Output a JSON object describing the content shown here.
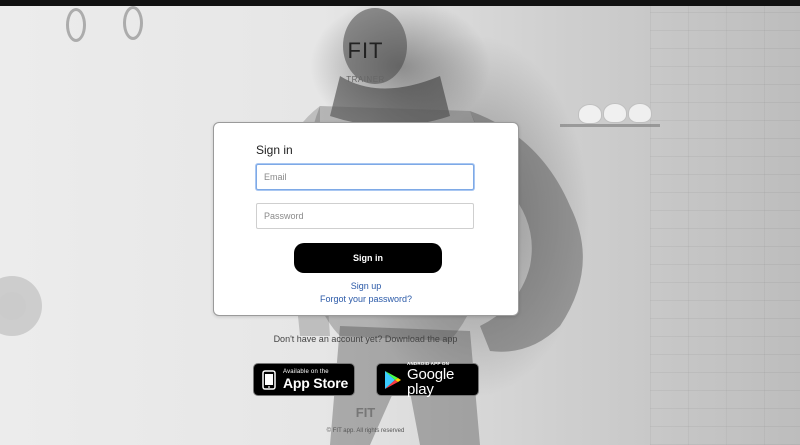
{
  "brand": {
    "title": "FIT",
    "subtitle": "TRAINER"
  },
  "login": {
    "heading": "Sign in",
    "email_placeholder": "Email",
    "email_value": "",
    "password_placeholder": "Password",
    "password_value": "",
    "submit_label": "Sign in",
    "signup_link": "Sign up",
    "forgot_link": "Forgot your password?"
  },
  "download": {
    "prompt": "Don't have an account yet? Download the app",
    "app_store": {
      "small_text": "Available on the",
      "big_text": "App Store",
      "icon": "apple-icon"
    },
    "google_play": {
      "small_text": "ANDROID APP ON",
      "big_text": "Google play",
      "icon": "google-play-icon"
    }
  },
  "footer": {
    "logo_text": "FIT",
    "copyright": "© FIT app. All rights reserved"
  },
  "colors": {
    "top_bar": "#111111",
    "card_bg": "#ffffff",
    "button_bg": "#000000",
    "link": "#2b5aa8",
    "focus_border": "#7ea9e6"
  }
}
